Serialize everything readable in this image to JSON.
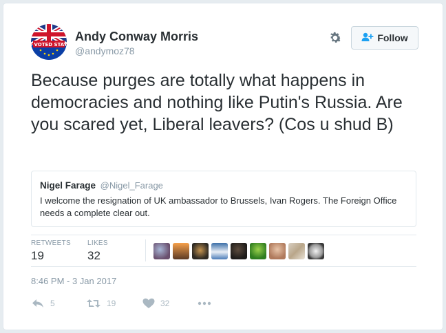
{
  "user": {
    "name": "Andy Conway Morris",
    "handle": "@andymoz78",
    "avatar_text": "I VOTED STAY"
  },
  "follow_button": {
    "label": "Follow"
  },
  "tweet": {
    "text": "Because purges are totally what happens in democracies and nothing like Putin's Russia. Are you scared yet, Liberal leavers? (Cos u shud B)"
  },
  "quoted_tweet": {
    "name": "Nigel Farage",
    "handle": "@Nigel_Farage",
    "text": "I welcome the resignation of UK ambassador to Brussels, Ivan Rogers. The Foreign Office needs a complete clear out."
  },
  "stats": {
    "retweets_label": "RETWEETS",
    "retweets_value": "19",
    "likes_label": "LIKES",
    "likes_value": "32"
  },
  "timestamp": "8:46 PM - 3 Jan 2017",
  "actions": {
    "reply_count": "5",
    "retweet_count": "19",
    "like_count": "32"
  },
  "colors": {
    "text": "#292f33",
    "muted": "#8899a6",
    "border": "#e1e8ed",
    "icon": "#aab8c2",
    "follow_icon": "#1da1f2"
  },
  "icons": [
    "gear-icon",
    "follow-person-icon",
    "reply-icon",
    "retweet-icon",
    "heart-icon",
    "more-icon"
  ]
}
